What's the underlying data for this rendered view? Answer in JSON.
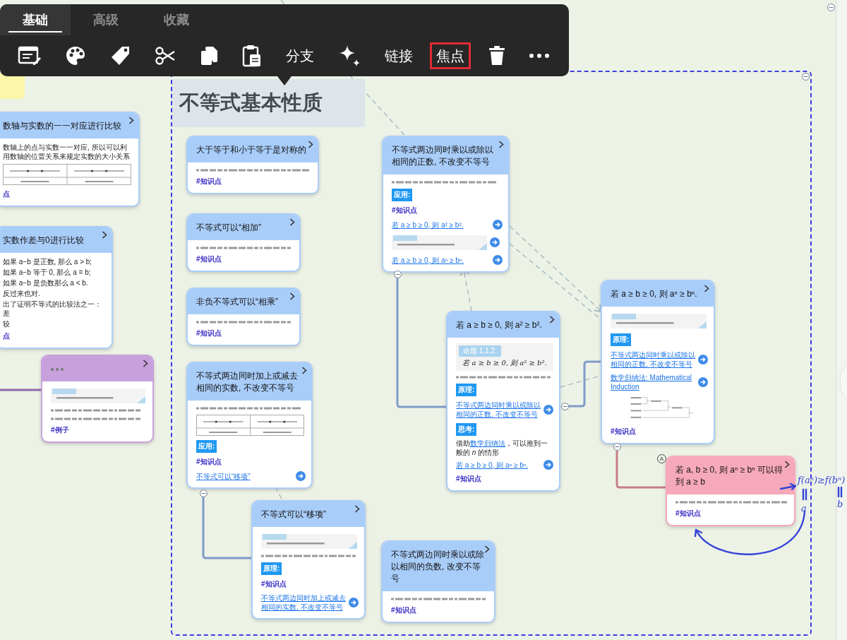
{
  "toolbar": {
    "tabs": [
      {
        "label": "基础",
        "selected": true
      },
      {
        "label": "高级",
        "selected": false
      },
      {
        "label": "收藏",
        "selected": false
      }
    ],
    "actions": [
      {
        "kind": "icon",
        "highlighted": false
      },
      {
        "kind": "icon",
        "highlighted": false
      },
      {
        "kind": "icon",
        "highlighted": false
      },
      {
        "kind": "icon",
        "highlighted": false
      },
      {
        "kind": "icon",
        "highlighted": false
      },
      {
        "kind": "icon",
        "highlighted": false
      },
      {
        "kind": "text",
        "label": "分支",
        "highlighted": false
      },
      {
        "kind": "icon",
        "highlighted": false
      },
      {
        "kind": "text",
        "label": "链接",
        "highlighted": false
      },
      {
        "kind": "text",
        "label": "焦点",
        "highlighted": true
      },
      {
        "kind": "icon",
        "highlighted": false
      },
      {
        "kind": "icon",
        "highlighted": false
      }
    ]
  },
  "focus_frame": {
    "title": "不等式基本性质"
  },
  "cards": [
    {
      "color": "#a9cdf9",
      "title": "数轴与实数的一一对应进行比较",
      "blocks": [
        {
          "kind": "text",
          "text": "数轴上的点与实数一一对应, 所以可以利用数轴的位置关系来规定实数的大小关系"
        },
        {
          "kind": "table"
        },
        {
          "kind": "tag",
          "text": "点"
        }
      ]
    },
    {
      "color": "#a9cdf9",
      "title": "实数作差与0进行比较",
      "blocks": [
        {
          "kind": "text",
          "text": "如果 a−b 是正数, 那么 a > b;"
        },
        {
          "kind": "text",
          "text": "如果 a−b 等于 0, 那么 a = b;"
        },
        {
          "kind": "text",
          "text": "如果 a−b 是负数那么 a < b."
        },
        {
          "kind": "text",
          "text": "反过来也对."
        },
        {
          "kind": "text",
          "text": "出了证明不等式的比较法之一：差"
        },
        {
          "kind": "text",
          "text": "较"
        },
        {
          "kind": "tag",
          "text": "点"
        }
      ]
    },
    {
      "color": "#c7a0dc",
      "blocks": [
        {
          "kind": "snippet"
        },
        {
          "kind": "formula"
        },
        {
          "kind": "formula"
        },
        {
          "kind": "tag",
          "text": "#例子"
        }
      ]
    },
    {
      "color": "#a9cdf9",
      "title": "大于等于和小于等于是对称的",
      "blocks": [
        {
          "kind": "formula"
        },
        {
          "kind": "tag",
          "text": "#知识点"
        }
      ]
    },
    {
      "color": "#a9cdf9",
      "title": "不等式可以“相加”",
      "blocks": [
        {
          "kind": "formula"
        },
        {
          "kind": "tag",
          "text": "#知识点"
        }
      ]
    },
    {
      "color": "#a9cdf9",
      "title": "非负不等式可以“相乘”",
      "blocks": [
        {
          "kind": "formula"
        },
        {
          "kind": "tag",
          "text": "#知识点"
        }
      ]
    },
    {
      "color": "#a9cdf9",
      "title": "不等式两边同时加上或减去相同的实数, 不改变不等号",
      "blocks": [
        {
          "kind": "formula"
        },
        {
          "kind": "table"
        },
        {
          "kind": "label",
          "text": "应用:"
        },
        {
          "kind": "tag",
          "text": "#知识点"
        },
        {
          "kind": "link",
          "text": "不等式可以“移项”"
        }
      ]
    },
    {
      "color": "#a9cdf9",
      "title": "不等式可以“移项”",
      "blocks": [
        {
          "kind": "snippet"
        },
        {
          "kind": "formula"
        },
        {
          "kind": "label",
          "text": "原理:"
        },
        {
          "kind": "tag",
          "text": "#知识点"
        },
        {
          "kind": "link",
          "text": "不等式两边同时加上或减去相同的实数, 不改变不等号"
        }
      ]
    },
    {
      "color": "#a9cdf9",
      "title": "不等式两边同时乘以或除以相同的正数, 不改变不等号",
      "blocks": [
        {
          "kind": "formula"
        },
        {
          "kind": "label",
          "text": "应用:"
        },
        {
          "kind": "tag",
          "text": "#知识点"
        },
        {
          "kind": "link",
          "text": "若 a ≥ b ≥ 0, 则 a² ≥ b²."
        },
        {
          "kind": "image_link"
        },
        {
          "kind": "link",
          "text": "若 a ≥ b ≥ 0, 则 aⁿ ≥ bⁿ."
        }
      ]
    },
    {
      "color": "#a9cdf9",
      "title": "不等式两边同时乘以或除以相同的负数, 改变不等号",
      "blocks": [
        {
          "kind": "formula"
        },
        {
          "kind": "tag",
          "text": "#知识点"
        }
      ]
    },
    {
      "color": "#a9cdf9",
      "title": "若 a ≥ b ≥ 0, 则 a² ≥ b².",
      "blocks": [
        {
          "kind": "proposition",
          "label": "命题 1.1.2.",
          "statement": "若 a ≥ b ≥ 0, 则 a² ≥ b²."
        },
        {
          "kind": "formula"
        },
        {
          "kind": "label",
          "text": "原理:"
        },
        {
          "kind": "link",
          "text": "不等式两边同时乘以或除以相同的正数, 不改变不等号"
        },
        {
          "kind": "label",
          "text": "思考:"
        },
        {
          "kind": "rich_text",
          "before": "借助",
          "link": "数学归纳法",
          "after": "，可以推到一般的 *n* 的情形"
        },
        {
          "kind": "link",
          "text": "若 a ≥ b ≥ 0, 则 aⁿ ≥ bⁿ."
        },
        {
          "kind": "tag",
          "text": "#知识点"
        }
      ]
    },
    {
      "color": "#a9cdf9",
      "title": "若 a ≥ b ≥ 0, 则 aⁿ ≥ bⁿ.",
      "blocks": [
        {
          "kind": "snippet"
        },
        {
          "kind": "label",
          "text": "原理:"
        },
        {
          "kind": "link",
          "text": "不等式两边同时乘以或除以相同的正数, 不改变不等号"
        },
        {
          "kind": "link",
          "text": "数学归纳法: Mathematical Induction"
        },
        {
          "kind": "diagram"
        },
        {
          "kind": "tag",
          "text": "#知识点"
        }
      ]
    },
    {
      "color": "#f6a9ba",
      "marker": "A",
      "title": "若 a, b ≥ 0, 则 aⁿ ≥ bⁿ 可以得到 a ≥ b",
      "blocks": [
        {
          "kind": "formula"
        },
        {
          "kind": "tag",
          "text": "#知识点"
        }
      ]
    }
  ],
  "handwriting": {
    "formula": "f(aⁿ)≥f(bⁿ)",
    "left": "a",
    "right": "b"
  }
}
